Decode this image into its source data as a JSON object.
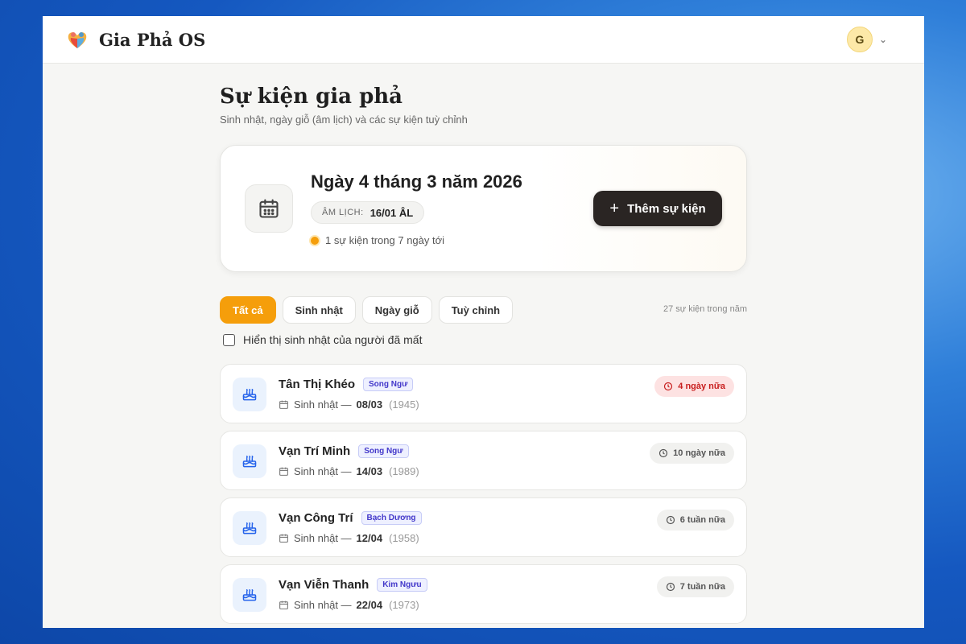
{
  "app": {
    "brand": "Gia Phả OS",
    "avatar_initial": "G"
  },
  "page": {
    "title": "Sự kiện gia phả",
    "subtitle": "Sinh nhật, ngày giỗ (âm lịch) và các sự kiện tuỳ chỉnh"
  },
  "hero": {
    "date": "Ngày 4 tháng 3 năm 2026",
    "lunar_label": "ÂM LỊCH:",
    "lunar_value": "16/01 ÂL",
    "upcoming_text": "1 sự kiện trong 7 ngày tới",
    "add_button": "Thêm sự kiện"
  },
  "tabs": [
    {
      "label": "Tất cả",
      "active": true
    },
    {
      "label": "Sinh nhật",
      "active": false
    },
    {
      "label": "Ngày giỗ",
      "active": false
    },
    {
      "label": "Tuỳ chỉnh",
      "active": false
    }
  ],
  "event_count": "27 sự kiện trong năm",
  "filter": {
    "label": "Hiển thị sinh nhật của người đã mất",
    "checked": false
  },
  "events": [
    {
      "name": "Tân Thị Khéo",
      "zodiac": "Song Ngư",
      "type": "Sinh nhật —",
      "date": "08/03",
      "year": "(1945)",
      "countdown": "4 ngày nữa",
      "soon": true
    },
    {
      "name": "Vạn Trí Minh",
      "zodiac": "Song Ngư",
      "type": "Sinh nhật —",
      "date": "14/03",
      "year": "(1989)",
      "countdown": "10 ngày nữa",
      "soon": false
    },
    {
      "name": "Vạn Công Trí",
      "zodiac": "Bạch Dương",
      "type": "Sinh nhật —",
      "date": "12/04",
      "year": "(1958)",
      "countdown": "6 tuần nữa",
      "soon": false
    },
    {
      "name": "Vạn Viễn Thanh",
      "zodiac": "Kim Ngưu",
      "type": "Sinh nhật —",
      "date": "22/04",
      "year": "(1973)",
      "countdown": "7 tuần nữa",
      "soon": false
    }
  ],
  "colors": {
    "accent": "#f59e0b",
    "dark_button": "#2a2523",
    "soon_badge": "#c81e1e"
  }
}
